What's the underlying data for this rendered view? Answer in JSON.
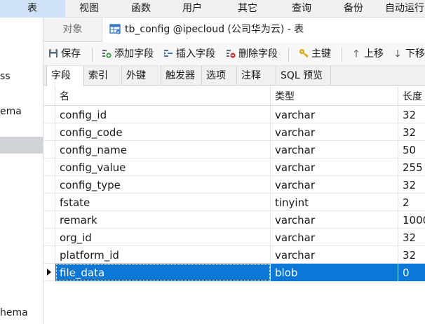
{
  "menu": {
    "items": [
      {
        "label": "表"
      },
      {
        "label": "视图"
      },
      {
        "label": "函数"
      },
      {
        "label": "用户"
      },
      {
        "label": "其它"
      },
      {
        "label": "查询"
      },
      {
        "label": "备份"
      },
      {
        "label": "自动运行"
      }
    ]
  },
  "sidebar": {
    "fragments": [
      "ss",
      "ema",
      "hema"
    ]
  },
  "tabs": {
    "object_label": "对象",
    "active_label": "tb_config @ipecloud (公司华为云) - 表"
  },
  "toolbar": {
    "save_label": "保存",
    "add_field_label": "添加字段",
    "insert_field_label": "插入字段",
    "delete_field_label": "删除字段",
    "primary_key_label": "主键",
    "move_up_label": "上移",
    "move_down_label": "下移"
  },
  "subtabs": [
    "字段",
    "索引",
    "外键",
    "触发器",
    "选项",
    "注释",
    "SQL 预览"
  ],
  "grid": {
    "columns": [
      "名",
      "类型",
      "长度"
    ],
    "rows": [
      {
        "name": "config_id",
        "type": "varchar",
        "length": "32"
      },
      {
        "name": "config_code",
        "type": "varchar",
        "length": "32"
      },
      {
        "name": "config_name",
        "type": "varchar",
        "length": "50"
      },
      {
        "name": "config_value",
        "type": "varchar",
        "length": "255"
      },
      {
        "name": "config_type",
        "type": "varchar",
        "length": "32"
      },
      {
        "name": "fstate",
        "type": "tinyint",
        "length": "2"
      },
      {
        "name": "remark",
        "type": "varchar",
        "length": "1000"
      },
      {
        "name": "org_id",
        "type": "varchar",
        "length": "32"
      },
      {
        "name": "platform_id",
        "type": "varchar",
        "length": "32"
      },
      {
        "name": "file_data",
        "type": "blob",
        "length": "0"
      }
    ],
    "selected_row": 9
  },
  "colors": {
    "selection": "#0b78d7",
    "active_menu": "#cfe2f7",
    "add_icon": "#2e9e3a",
    "delete_icon": "#d13438",
    "key_icon": "#d9a400"
  },
  "icons": {
    "save": "save-icon",
    "add_field": "add-field-icon",
    "insert_field": "insert-field-icon",
    "delete_field": "delete-field-icon",
    "primary_key": "key-icon",
    "move_up": "arrow-up-icon",
    "move_down": "arrow-down-icon",
    "table": "table-icon"
  }
}
